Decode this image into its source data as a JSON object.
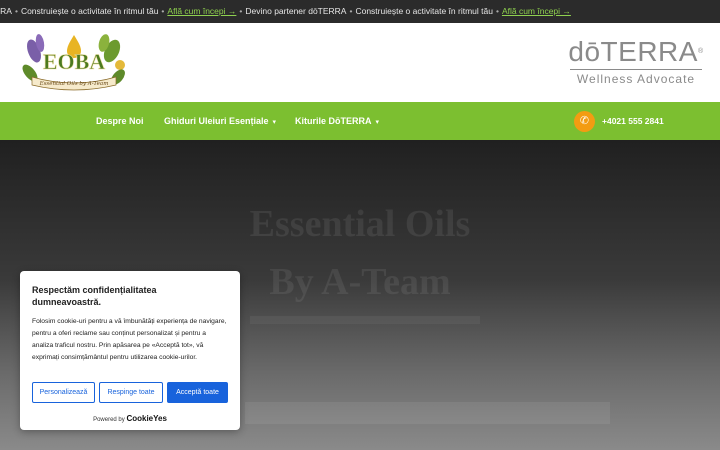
{
  "ticker": {
    "part1": "RRA",
    "part2": "Construiește o activitate în ritmul tău",
    "link1": "Află cum începi →",
    "part3": "Devino partener dōTERRA",
    "part4": "Construiește o activitate în ritmul tău",
    "link2": "Află cum începi →"
  },
  "header": {
    "logo_main": "EOBA",
    "logo_tagline": "Essential Oils by A-Team",
    "doterra_word": "dōTERRA",
    "doterra_tm": "®",
    "doterra_sub": "Wellness Advocate"
  },
  "nav": {
    "items": [
      {
        "label": "Despre Noi"
      },
      {
        "label": "Ghiduri Uleiuri Esențiale"
      },
      {
        "label": "Kiturile DōTERRA"
      }
    ],
    "phone": "+4021 555 2841"
  },
  "hero": {
    "title_line1": "Essential Oils",
    "title_line2": "By A-Team"
  },
  "cookie": {
    "title": "Respectăm confidențialitatea dumneavoastră.",
    "body": "Folosim cookie-uri pentru a vă îmbunătăți experiența de navigare, pentru a oferi reclame sau conținut personalizat și pentru a analiza traficul nostru. Prin apăsarea pe «Acceptă tot», vă exprimați consimțământul pentru utilizarea cookie-urilor.",
    "btn_customize": "Personalizează",
    "btn_reject": "Respinge toate",
    "btn_accept": "Acceptă toate",
    "powered_by": "Powered by",
    "powered_brand": "CookieYes"
  },
  "colors": {
    "nav_green": "#7cbf30",
    "accent_orange": "#f39c12",
    "cookie_blue": "#1863dc",
    "ticker_link": "#8fd14f"
  }
}
